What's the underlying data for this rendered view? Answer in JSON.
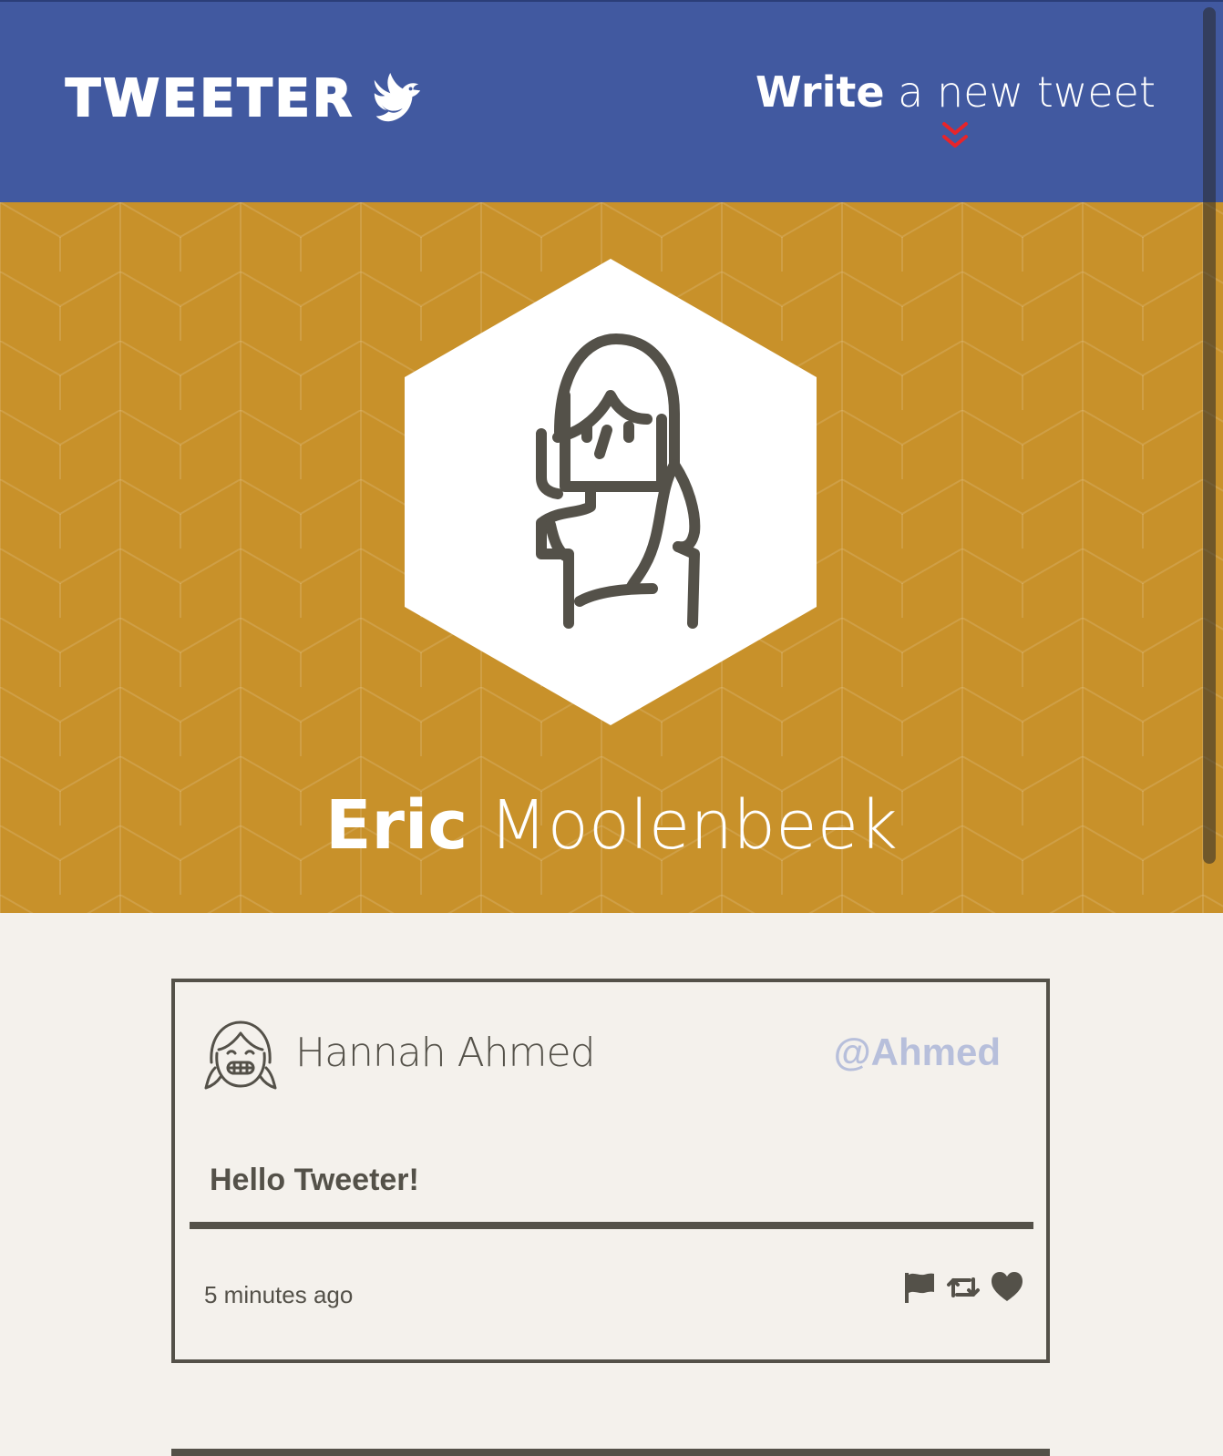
{
  "nav": {
    "logo_text": "TWEETER",
    "logo_icon": "bird-icon",
    "compose_strong": "Write",
    "compose_rest": " a new tweet",
    "compose_icon": "double-chevron-down-icon",
    "compose_icon_color": "#e8242a"
  },
  "profile": {
    "first_name": "Eric",
    "last_name": " Moolenbeek",
    "avatar_icon": "person-long-hair-icon",
    "background_color": "#c8912a"
  },
  "tweet": {
    "avatar_icon": "smiling-girl-avatar-icon",
    "user_name": "Hannah Ahmed",
    "handle": "@Ahmed",
    "content": "Hello Tweeter!",
    "timestamp": "5 minutes ago",
    "actions": [
      "flag-icon",
      "retweet-icon",
      "heart-icon"
    ]
  },
  "colors": {
    "nav": "#4159a0",
    "accent": "#e8242a",
    "text": "#545149",
    "handle": "#b7bfdb",
    "page_bg": "#f4f1ec"
  }
}
